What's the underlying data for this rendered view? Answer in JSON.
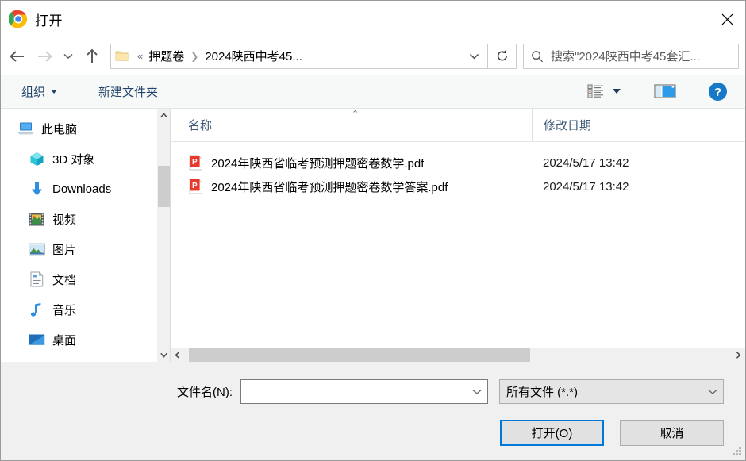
{
  "window": {
    "title": "打开",
    "app_icon": "chrome-icon",
    "close_label": "✕"
  },
  "nav": {
    "back": "back-arrow-icon",
    "forward": "forward-arrow-icon",
    "recent": "chevron-down-icon",
    "up": "up-arrow-icon",
    "refresh": "refresh-icon",
    "breadcrumb": {
      "folder_icon": "folder-icon",
      "overflow": "«",
      "items": [
        "押题卷",
        "2024陕西中考45..."
      ],
      "separator": "❯",
      "dropdown": "chevron-down-icon"
    },
    "search": {
      "icon": "search-icon",
      "placeholder": "搜索\"2024陕西中考45套汇..."
    }
  },
  "command_bar": {
    "organize": "组织",
    "new_folder": "新建文件夹",
    "view_icon": "view-list-icon",
    "pane_icon": "preview-pane-icon",
    "help_icon": "help-icon",
    "help_label": "?"
  },
  "sidebar": {
    "items": [
      {
        "label": "此电脑",
        "icon": "computer-icon",
        "root": true
      },
      {
        "label": "3D 对象",
        "icon": "3d-objects-icon",
        "root": false
      },
      {
        "label": "Downloads",
        "icon": "downloads-icon",
        "root": false
      },
      {
        "label": "视频",
        "icon": "videos-icon",
        "root": false
      },
      {
        "label": "图片",
        "icon": "pictures-icon",
        "root": false
      },
      {
        "label": "文档",
        "icon": "documents-icon",
        "root": false
      },
      {
        "label": "音乐",
        "icon": "music-icon",
        "root": false
      },
      {
        "label": "桌面",
        "icon": "desktop-icon",
        "root": false
      }
    ]
  },
  "file_list": {
    "sort_indicator": "⌃",
    "columns": [
      "名称",
      "修改日期"
    ],
    "rows": [
      {
        "name": "2024年陕西省临考预测押题密卷数学.pdf",
        "date": "2024/5/17 13:42",
        "icon": "pdf-file-icon"
      },
      {
        "name": "2024年陕西省临考预测押题密卷数学答案.pdf",
        "date": "2024/5/17 13:42",
        "icon": "pdf-file-icon"
      }
    ]
  },
  "footer": {
    "filename_label": "文件名(N):",
    "filename_value": "",
    "filetype_value": "所有文件 (*.*)",
    "open_button": "打开(O)",
    "cancel_button": "取消"
  },
  "colors": {
    "accent": "#0078d7",
    "link_text": "#22456b",
    "header_text": "#3d5a76",
    "pdf_red": "#e8392c"
  }
}
